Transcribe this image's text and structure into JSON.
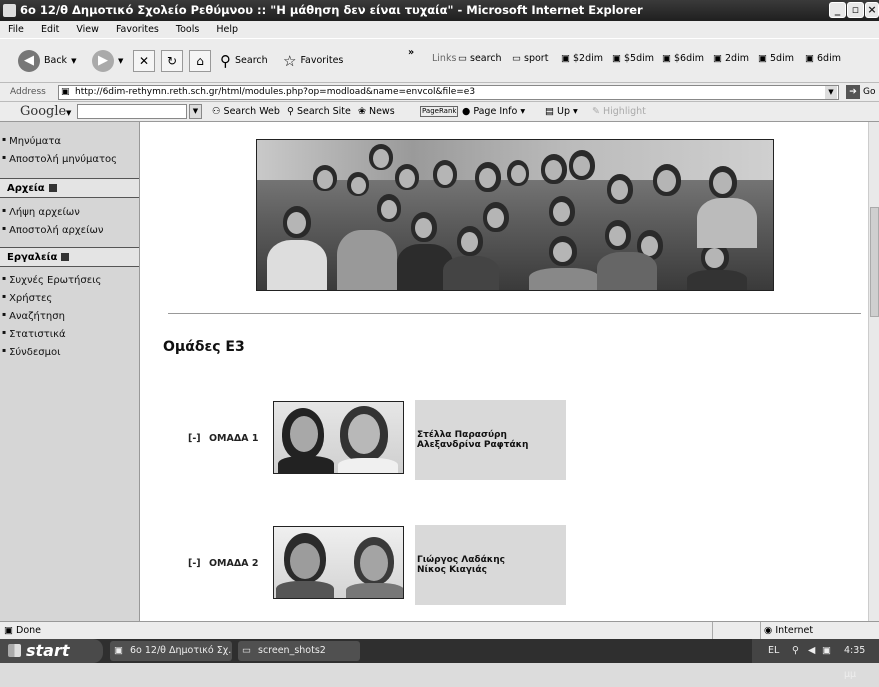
{
  "window": {
    "title": "6ο 12/θ Δημοτικό Σχολείο Ρεθύμνου :: \"Η μάθηση δεν είναι τυχαία\" - Microsoft Internet Explorer"
  },
  "menu": [
    "File",
    "Edit",
    "View",
    "Favorites",
    "Tools",
    "Help"
  ],
  "toolbar": {
    "back": "Back",
    "search": "Search",
    "favorites": "Favorites",
    "links_label": "Links",
    "links": [
      "search",
      "sport",
      "$2dim",
      "$5dim",
      "$6dim",
      "2dim",
      "5dim",
      "6dim"
    ]
  },
  "address": {
    "label": "Address",
    "url": "http://6dim-rethymn.reth.sch.gr/html/modules.php?op=modload&name=envcol&file=e3",
    "go": "Go"
  },
  "google": {
    "logo": "Google",
    "search_web": "Search Web",
    "search_site": "Search Site",
    "news": "News",
    "pagerank": "PageRank",
    "page_info": "Page Info",
    "up": "Up",
    "highlight": "Highlight"
  },
  "sidebar": {
    "top_items": [
      "Μηνύματα",
      "Αποστολή μηνύματος"
    ],
    "files_header": "Αρχεία",
    "files_items": [
      "Λήψη αρχείων",
      "Αποστολή αρχείων"
    ],
    "tools_header": "Εργαλεία",
    "tools_items": [
      "Συχνές Ερωτήσεις",
      "Χρήστες",
      "Αναζήτηση",
      "Στατιστικά",
      "Σύνδεσμοι"
    ]
  },
  "main": {
    "heading": "Ομάδες Ε3",
    "teams": [
      {
        "toggle": "[-]",
        "label": "ΟΜΑΔΑ 1",
        "members": [
          "Στέλλα Παρασύρη",
          "Αλεξανδρίνα Ραφτάκη"
        ]
      },
      {
        "toggle": "[-]",
        "label": "ΟΜΑΔΑ 2",
        "members": [
          "Γιώργος Λαδάκης",
          "Νίκος Κιαγιάς"
        ]
      }
    ]
  },
  "status": {
    "text": "Done",
    "zone": "Internet"
  },
  "taskbar": {
    "start": "start",
    "tasks": [
      "6ο 12/θ Δημοτικό Σχ...",
      "screen_shots2"
    ],
    "lang": "EL",
    "clock": "4:35 μμ"
  }
}
